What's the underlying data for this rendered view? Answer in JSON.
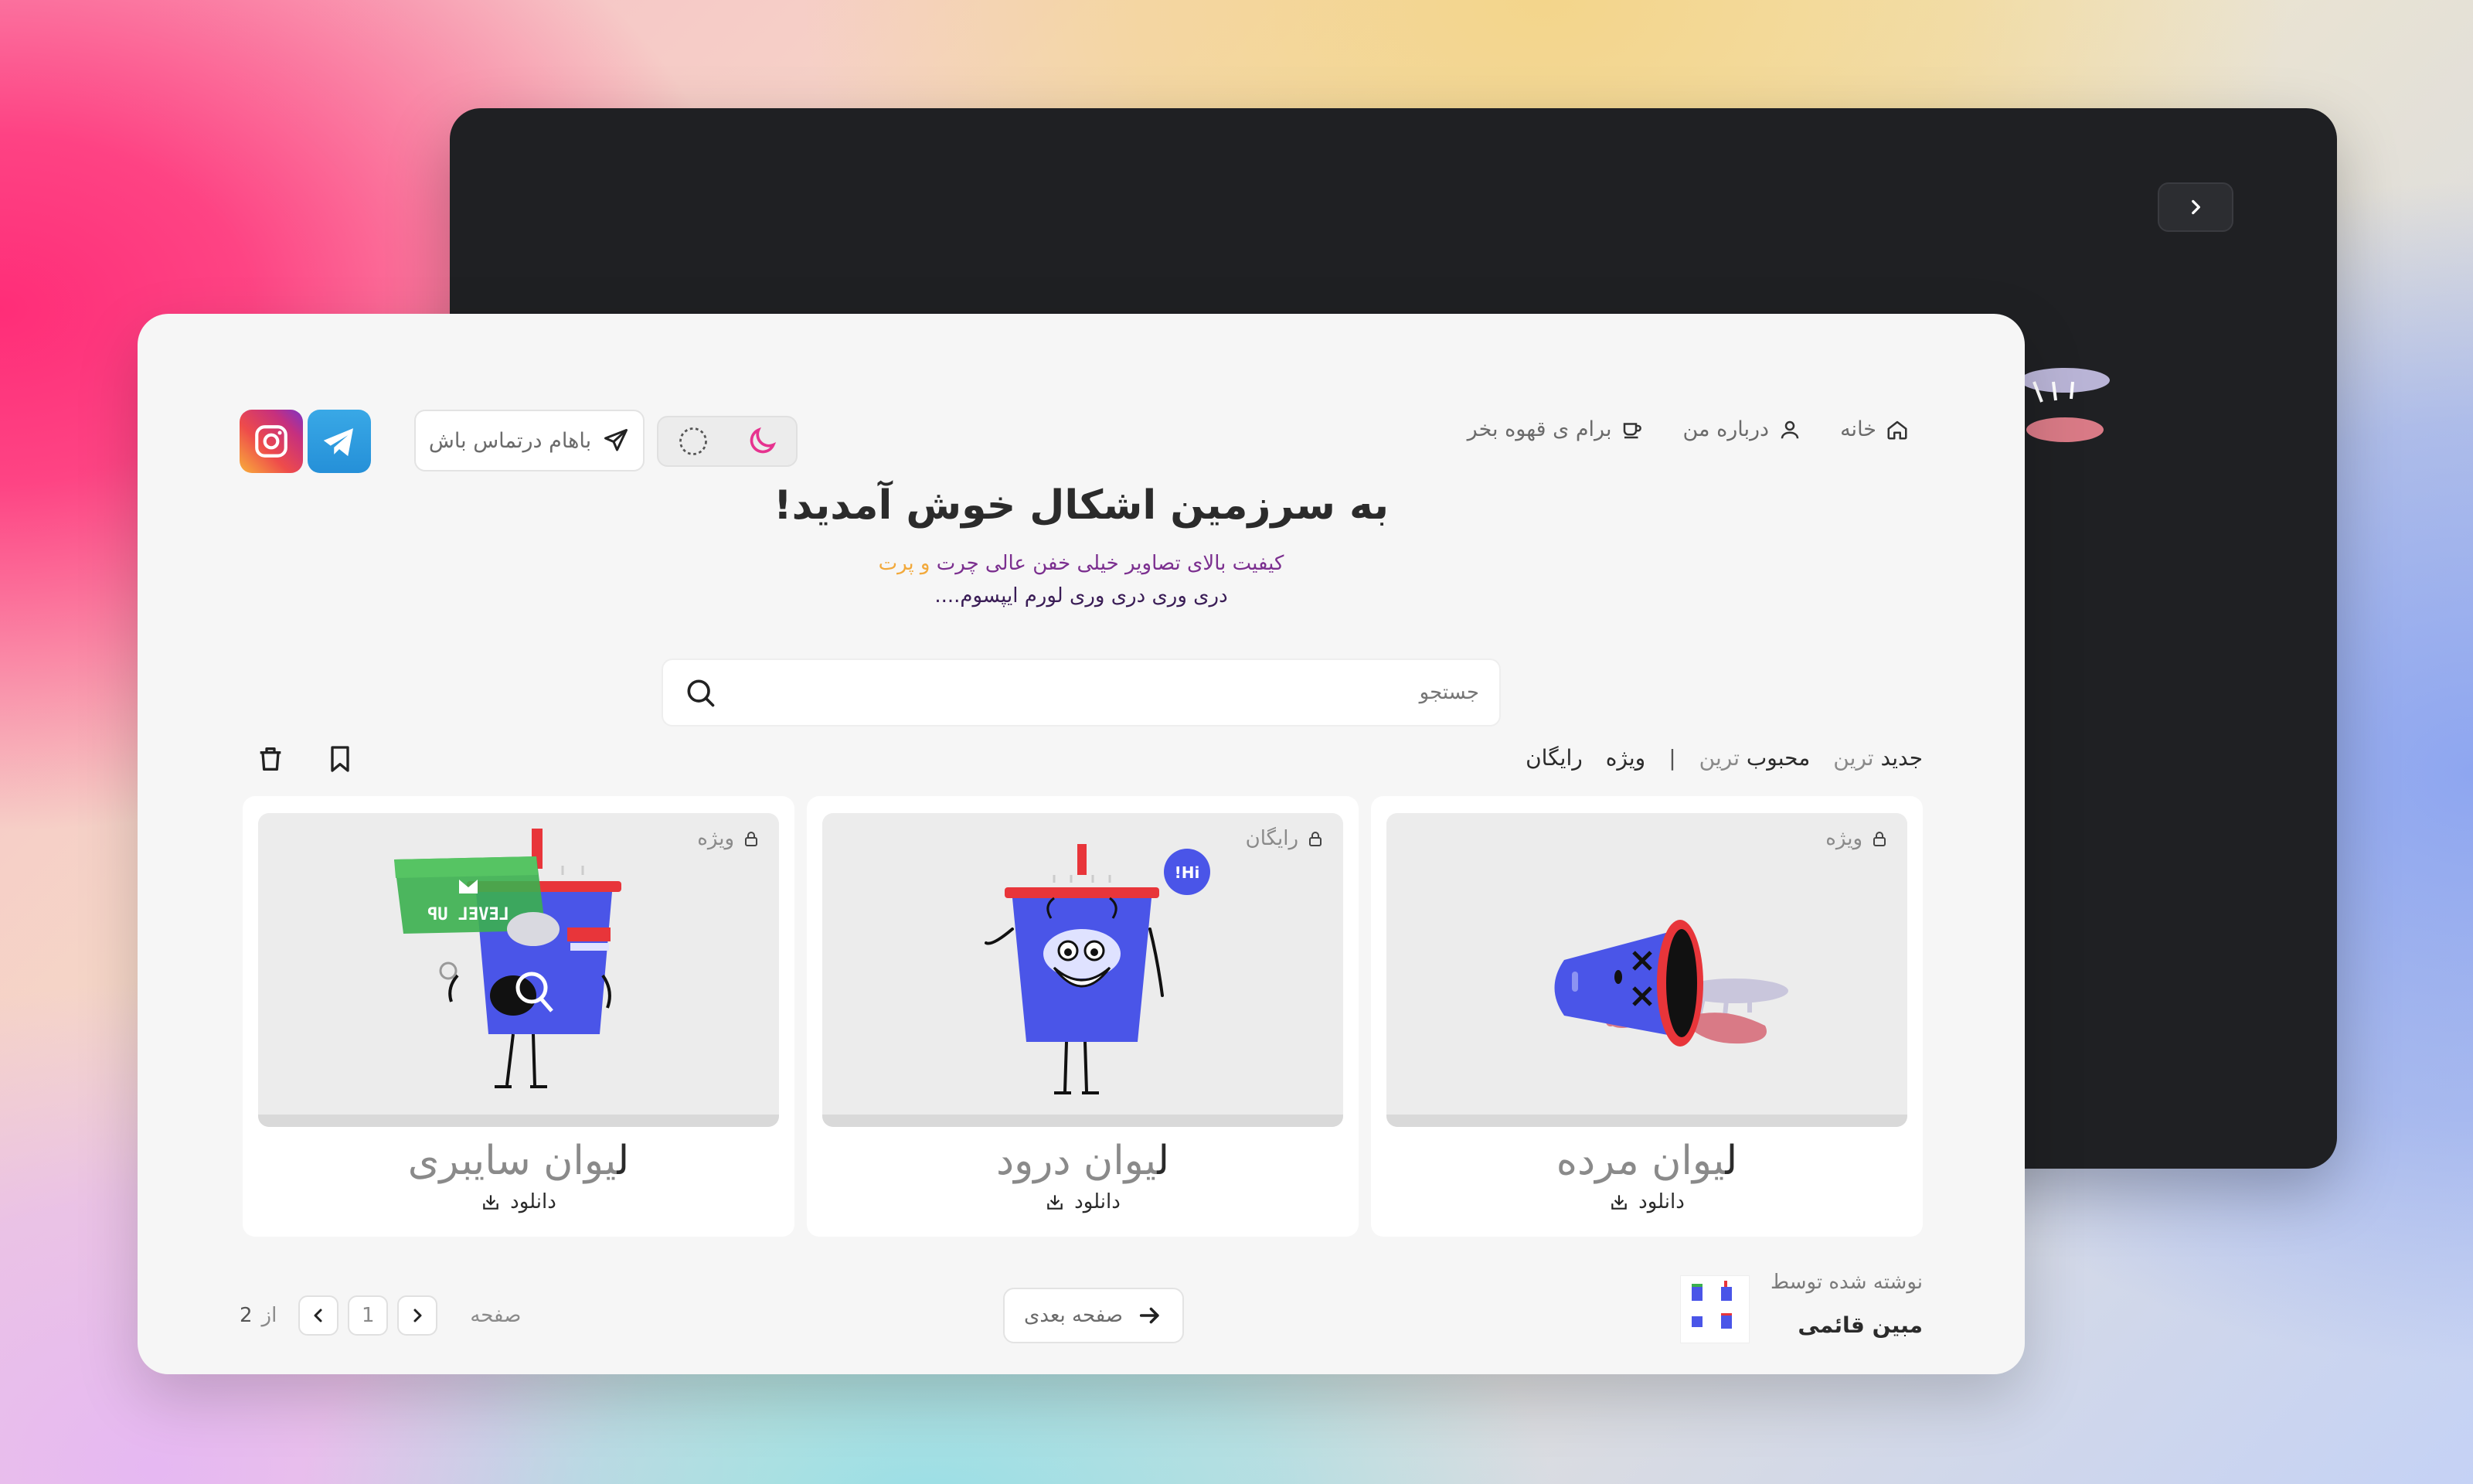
{
  "nav": {
    "home": "خانه",
    "about": "درباره من",
    "coffee": "برام ی قهوه بخر"
  },
  "contact": {
    "label": "باهام درتماس باش"
  },
  "hero": {
    "title": "به سرزمین اشکال خوش آمدید!",
    "line1_part1": "کیفیت بالای تصاویر خیلی خفن عالی چرت",
    "line1_part2": " و ",
    "line1_part3": "پرت",
    "line2": "دری وری دری وری لورم ایپسوم...."
  },
  "search": {
    "placeholder": "جستجو"
  },
  "filters": {
    "newest_a": "جدید",
    "newest_b": " ترین",
    "popular_a": "محبوب",
    "popular_b": " ترین",
    "separator": "|",
    "special": "ویژه",
    "free": "رایگان"
  },
  "products": [
    {
      "badge": "ویژه",
      "title_first": "ل",
      "title_rest": "یوان مرده",
      "download": "دانلود"
    },
    {
      "badge": "رایگان",
      "title_first": "ل",
      "title_rest": "یوان درود",
      "download": "دانلود"
    },
    {
      "badge": "ویژه",
      "title_first": "ل",
      "title_rest": "یوان سایبری",
      "download": "دانلود"
    }
  ],
  "illustration_text": {
    "hi": "Hi!",
    "level_up": "LEVEL UP"
  },
  "author": {
    "by": "نوشته شده توسط",
    "name": "مبین قائمی"
  },
  "next": {
    "label": "صفحه بعدی"
  },
  "pager": {
    "label": "صفحه",
    "current": "1",
    "of": "از",
    "total": "2"
  },
  "colors": {
    "accent_pink": "#e6338f",
    "cup_blue": "#4a55e8",
    "cup_red": "#e8353a"
  }
}
